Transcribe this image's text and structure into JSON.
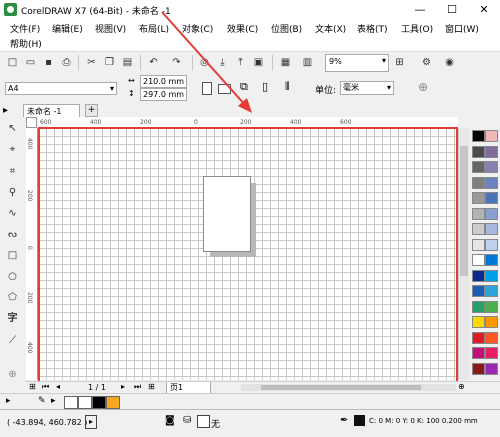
{
  "window": {
    "title": "CorelDRAW X7 (64-Bit) - 未命名 -1",
    "minimize": "—",
    "maximize": "☐",
    "close": "✕"
  },
  "menu": [
    "文件(F)",
    "编辑(E)",
    "视图(V)",
    "布局(L)",
    "对象(C)",
    "效果(C)",
    "位图(B)",
    "文本(X)",
    "表格(T)",
    "工具(O)",
    "窗口(W)",
    "帮助(H)"
  ],
  "toolbar": {
    "zoom": "9%"
  },
  "propbar": {
    "page_size": "A4",
    "width": "210.0 mm",
    "height": "297.0 mm",
    "unit_label": "单位:",
    "unit_value": "毫米"
  },
  "doc_tab": {
    "label": "未命名 -1",
    "add": "+"
  },
  "ruler": {
    "h_labels": [
      "600",
      "400",
      "200",
      "0",
      "200",
      "400",
      "600"
    ],
    "v_labels": [
      "400",
      "200",
      "0",
      "200",
      "400"
    ]
  },
  "pagebar": {
    "page_counter": "1 / 1",
    "page_tab": "页1"
  },
  "status": {
    "coords": "( -43.894, 460.782 )",
    "fill_label": "无",
    "color_info": "C: 0 M: 0 Y: 0 K: 100  0.200 mm"
  },
  "colors": {
    "highlight": "#e53b35",
    "palette_left": [
      "#000000",
      "#4a4a4a",
      "#666666",
      "#7f7f7f",
      "#999999",
      "#b2b2b2",
      "#cccccc",
      "#e5e5e5",
      "#ffffff",
      "#0a2a8c",
      "#1a5fb4",
      "#26a269",
      "#ffd700",
      "#e01b24",
      "#c51077",
      "#8b1a1a"
    ],
    "palette_right": [
      "#f2b8b8",
      "#7d6b9e",
      "#8b7fb0",
      "#6a82c0",
      "#4a73b8",
      "#8aa0d0",
      "#a8b8e0",
      "#c0d0f0",
      "#0078d7",
      "#00a0e9",
      "#2fa4d8",
      "#4cb050",
      "#ff9800",
      "#ff5722",
      "#e91e63",
      "#9c27b0"
    ]
  }
}
